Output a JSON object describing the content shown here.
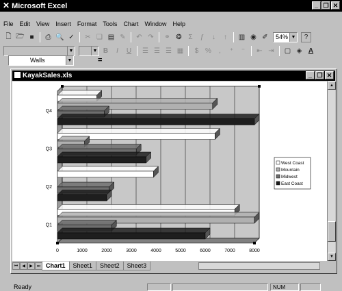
{
  "app": {
    "title": "Microsoft Excel"
  },
  "menu": [
    "File",
    "Edit",
    "View",
    "Insert",
    "Format",
    "Tools",
    "Chart",
    "Window",
    "Help"
  ],
  "toolbar": {
    "zoom": "54%",
    "help": "?"
  },
  "namebox": {
    "value": "Walls",
    "equals": "="
  },
  "workbook": {
    "title": "KayakSales.xls"
  },
  "sheets": [
    "Chart1",
    "Sheet1",
    "Sheet2",
    "Sheet3"
  ],
  "active_sheet": "Chart1",
  "status": {
    "left": "Ready",
    "num": "NUM"
  },
  "chart_data": {
    "type": "bar",
    "orientation": "horizontal",
    "categories": [
      "Q1",
      "Q2",
      "Q3",
      "Q4"
    ],
    "series": [
      {
        "name": "West Coast",
        "values": [
          7200,
          3900,
          6400,
          1600
        ],
        "color": "#ffffff"
      },
      {
        "name": "Mountain",
        "values": [
          8000,
          0,
          1100,
          6300
        ],
        "color": "#b0b0b0"
      },
      {
        "name": "Midwest",
        "values": [
          2200,
          2100,
          3200,
          1900
        ],
        "color": "#6e6e6e"
      },
      {
        "name": "East Coast",
        "values": [
          6000,
          2000,
          3600,
          8000
        ],
        "color": "#1e1e1e"
      }
    ],
    "xlim": [
      0,
      8000
    ],
    "xticks": [
      "0",
      "1000",
      "2000",
      "3000",
      "4000",
      "5000",
      "6000",
      "7000",
      "8000"
    ],
    "grid": true,
    "legend": "right"
  }
}
